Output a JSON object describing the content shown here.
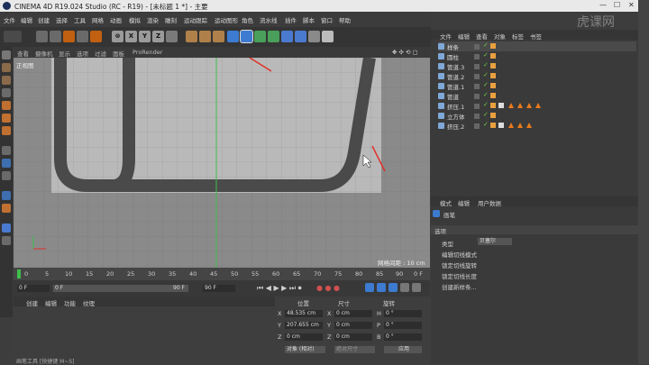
{
  "window": {
    "title": "CINEMA 4D R19.024 Studio (RC - R19) - [未标题 1 *] - 主要",
    "min": "—",
    "max": "☐",
    "close": "✕"
  },
  "menu": [
    "文件",
    "编辑",
    "创建",
    "选择",
    "工具",
    "网格",
    "动画",
    "模拟",
    "渲染",
    "雕刻",
    "运动跟踪",
    "运动图形",
    "角色",
    "流水线",
    "插件",
    "脚本",
    "窗口",
    "帮助"
  ],
  "toolbar": {
    "x": "X",
    "y": "Y",
    "z": "Z"
  },
  "viewport": {
    "menu": [
      "查看",
      "摄像机",
      "显示",
      "选项",
      "过滤",
      "面板",
      "ProRender"
    ],
    "label": "正视图",
    "grid_spacing": "网格间距 : 10 cm"
  },
  "timeline": {
    "ticks": [
      "0",
      "5",
      "10",
      "15",
      "20",
      "25",
      "30",
      "35",
      "40",
      "45",
      "50",
      "55",
      "60",
      "65",
      "70",
      "75",
      "80",
      "85",
      "90"
    ],
    "current": "0 F"
  },
  "transport": {
    "start": "0 F",
    "start2": "0 F",
    "end": "90 F",
    "end2": "90 F"
  },
  "material": {
    "menu": [
      "创建",
      "编辑",
      "功能",
      "纹理"
    ]
  },
  "coords": {
    "headers": [
      "位置",
      "尺寸",
      "旋转"
    ],
    "rows": [
      {
        "axis": "X",
        "pos": "48.535 cm",
        "axis2": "X",
        "size": "0 cm",
        "rot_axis": "H",
        "rot": "0 °"
      },
      {
        "axis": "Y",
        "pos": "207.655 cm",
        "axis2": "Y",
        "size": "0 cm",
        "rot_axis": "P",
        "rot": "0 °"
      },
      {
        "axis": "Z",
        "pos": "0 cm",
        "axis2": "Z",
        "size": "0 cm",
        "rot_axis": "B",
        "rot": "0 °"
      }
    ],
    "mode": "对象 (相对)",
    "size_mode": "绝对尺寸",
    "apply": "应用"
  },
  "objects": {
    "tabs": [
      "文件",
      "编辑",
      "查看",
      "对象",
      "标签",
      "书签"
    ],
    "rows": [
      {
        "name": "样条",
        "color": "#7fa8d8",
        "tags": 1,
        "tris": 0
      },
      {
        "name": "圆柱",
        "color": "#7fa8d8",
        "tags": 1,
        "tris": 0
      },
      {
        "name": "管道.3",
        "color": "#7fa8d8",
        "tags": 1,
        "tris": 0
      },
      {
        "name": "管道.2",
        "color": "#7fa8d8",
        "tags": 1,
        "tris": 0
      },
      {
        "name": "管道.1",
        "color": "#7fa8d8",
        "tags": 1,
        "tris": 0
      },
      {
        "name": "管道",
        "color": "#7fa8d8",
        "tags": 1,
        "tris": 0
      },
      {
        "name": "挤压.1",
        "color": "#7fa8d8",
        "tags": 2,
        "tris": 4
      },
      {
        "name": "立方体",
        "color": "#7fa8d8",
        "tags": 1,
        "tris": 0
      },
      {
        "name": "挤压.2",
        "color": "#7fa8d8",
        "tags": 2,
        "tris": 3
      }
    ]
  },
  "attributes": {
    "tabs": [
      "模式",
      "编辑",
      "用户数据"
    ],
    "object": "画笔",
    "section": "选项",
    "type_label": "类型",
    "type_value": "贝塞尔",
    "options": [
      "编辑切线模式",
      "锁定切线旋转",
      "锁定切线长度",
      "创建新样条..."
    ]
  },
  "status": {
    "text": "画笔工具 [快捷键 M~S]"
  },
  "watermark": "虎课网",
  "colors": {
    "accent": "#e87a1d",
    "annotation": "#e0302a",
    "grid_bg": "#8d8d8d",
    "spline": "#4a4a4a",
    "green_axis": "#3dbf4a"
  }
}
